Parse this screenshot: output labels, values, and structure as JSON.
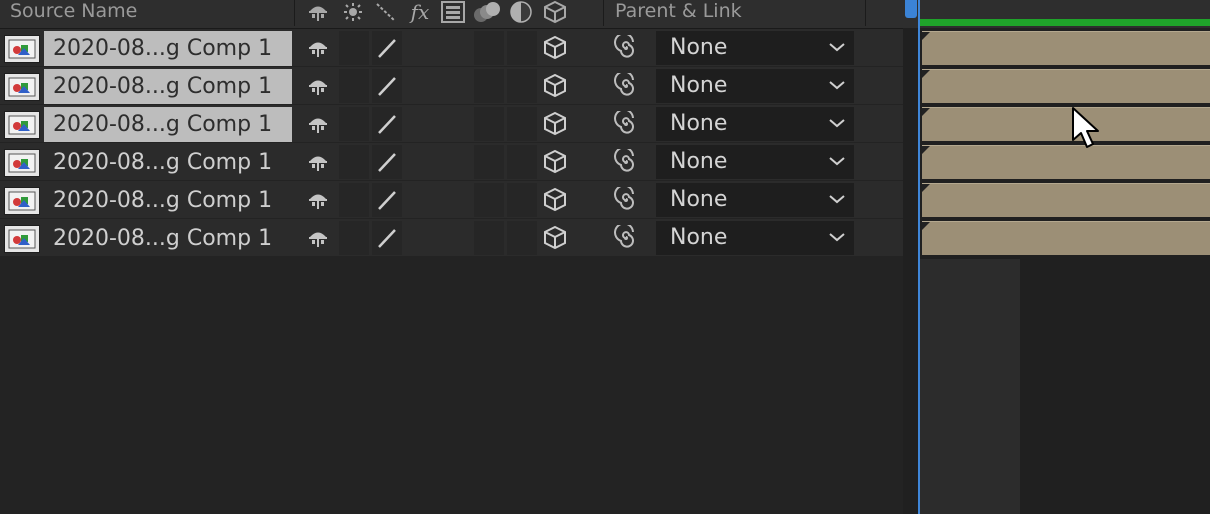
{
  "header": {
    "source_name_label": "Source Name",
    "parent_link_label": "Parent & Link",
    "switch_icons": [
      "shy-icon",
      "collapse-icon",
      "quality-icon",
      "fx-icon",
      "frame-blend-icon",
      "motion-blur-icon",
      "adjustment-icon",
      "3d-layer-icon"
    ]
  },
  "layers": [
    {
      "name": "2020-08...g Comp 1",
      "parent": "None",
      "selected": true
    },
    {
      "name": "2020-08...g Comp 1",
      "parent": "None",
      "selected": true
    },
    {
      "name": "2020-08...g Comp 1",
      "parent": "None",
      "selected": true
    },
    {
      "name": "2020-08...g Comp 1",
      "parent": "None",
      "selected": false
    },
    {
      "name": "2020-08...g Comp 1",
      "parent": "None",
      "selected": false
    },
    {
      "name": "2020-08...g Comp 1",
      "parent": "None",
      "selected": false
    }
  ],
  "colors": {
    "panel_bg": "#232323",
    "selected_name_bg": "#bdbdbd",
    "layer_bar": "#9c8f76",
    "work_area": "#1fa32a",
    "time_indicator": "#3f86d8"
  }
}
